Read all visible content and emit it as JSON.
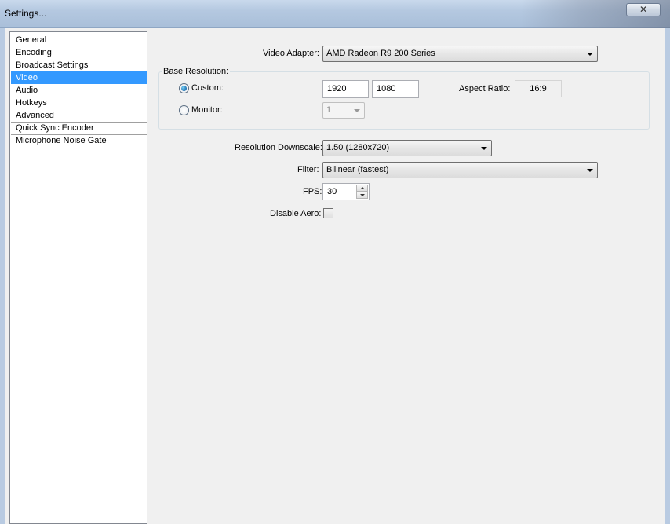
{
  "window": {
    "title": "Settings...",
    "close_glyph": "✕"
  },
  "sidebar": {
    "items": [
      {
        "label": "General"
      },
      {
        "label": "Encoding"
      },
      {
        "label": "Broadcast Settings"
      },
      {
        "label": "Video",
        "selected": true
      },
      {
        "label": "Audio"
      },
      {
        "label": "Hotkeys"
      },
      {
        "label": "Advanced"
      },
      {
        "label": "Quick Sync Encoder"
      },
      {
        "label": "Microphone Noise Gate"
      }
    ]
  },
  "video": {
    "adapter_label": "Video Adapter:",
    "adapter_value": "AMD Radeon R9 200 Series",
    "base_resolution": {
      "title": "Base Resolution:",
      "custom_label": "Custom:",
      "custom_checked": true,
      "width": "1920",
      "height": "1080",
      "aspect_label": "Aspect Ratio:",
      "aspect_value": "16:9",
      "monitor_label": "Monitor:",
      "monitor_value": "1"
    },
    "downscale_label": "Resolution Downscale:",
    "downscale_value": "1.50  (1280x720)",
    "filter_label": "Filter:",
    "filter_value": "Bilinear (fastest)",
    "fps_label": "FPS:",
    "fps_value": "30",
    "disable_aero_label": "Disable Aero:",
    "disable_aero_checked": false
  },
  "colors": {
    "selection": "#3399ff",
    "titlebar": "#b4c8e0"
  }
}
